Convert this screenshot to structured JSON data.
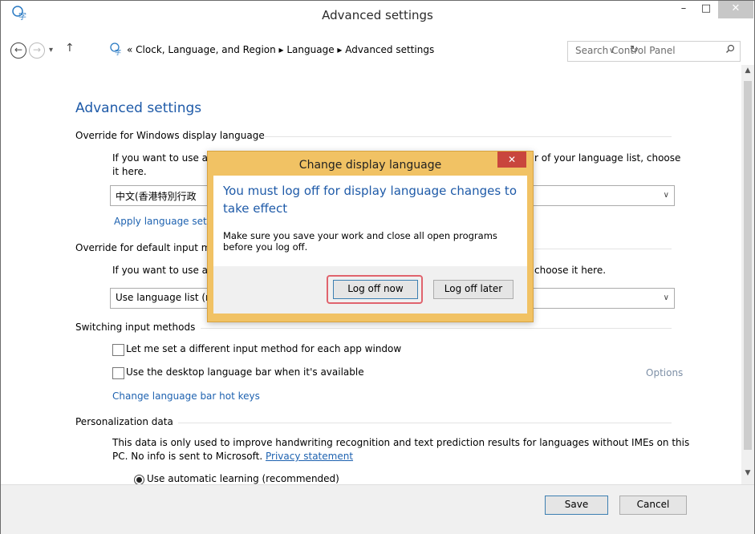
{
  "window": {
    "title": "Advanced settings",
    "minimize": "–",
    "maximize": "□",
    "close": "✕"
  },
  "address": {
    "back": "←",
    "forward": "→",
    "dropdown": "▾",
    "up": "↑",
    "prefix": "«",
    "path": [
      "Clock, Language, and Region",
      "Language",
      "Advanced settings"
    ],
    "path_text": "Clock, Language, and Region  ▸  Language  ▸  Advanced settings",
    "chevron": "∨",
    "refresh": "↻",
    "search_placeholder": "Search Control Panel",
    "search_glyph": "⚲"
  },
  "page": {
    "title": "Advanced settings",
    "override_display": {
      "heading": "Override for Windows display language",
      "para_left": "If you want to use a d",
      "para_right": "r of your language list, choose",
      "para_line2": "it here.",
      "dropdown_value": "中文(香港特別行政",
      "link": "Apply language sett"
    },
    "override_input": {
      "heading": "Override for default input m",
      "para_left": "If you want to use ar",
      "para_right": "choose it here.",
      "dropdown_value": "Use language list (re"
    },
    "switching": {
      "heading": "Switching input methods",
      "check1": "Let me set a different input method for each app window",
      "check2": "Use the desktop language bar when it's available",
      "options": "Options",
      "hotkeys_link": "Change language bar hot keys"
    },
    "personalization": {
      "heading": "Personalization data",
      "para_line1": "This data is only used to improve handwriting recognition and text prediction results for languages without IMEs on this",
      "para_line2": "PC. No info is sent to Microsoft.",
      "privacy_link": "Privacy statement",
      "radio_label": "Use automatic learning (recommended)"
    }
  },
  "footer": {
    "save": "Save",
    "cancel": "Cancel"
  },
  "dialog": {
    "title": "Change display language",
    "close": "✕",
    "heading": "You must log off for display language changes to take effect",
    "text": "Make sure you save your work and close all open programs before you log off.",
    "log_off_now": "Log off now",
    "log_off_later": "Log off later"
  },
  "scroll": {
    "up": "▲",
    "down": "▼"
  },
  "colors": {
    "link": "#1e62b0",
    "title_blue": "#1e5aa8",
    "dialog_border": "#f1c264",
    "close_red": "#c9463d"
  }
}
